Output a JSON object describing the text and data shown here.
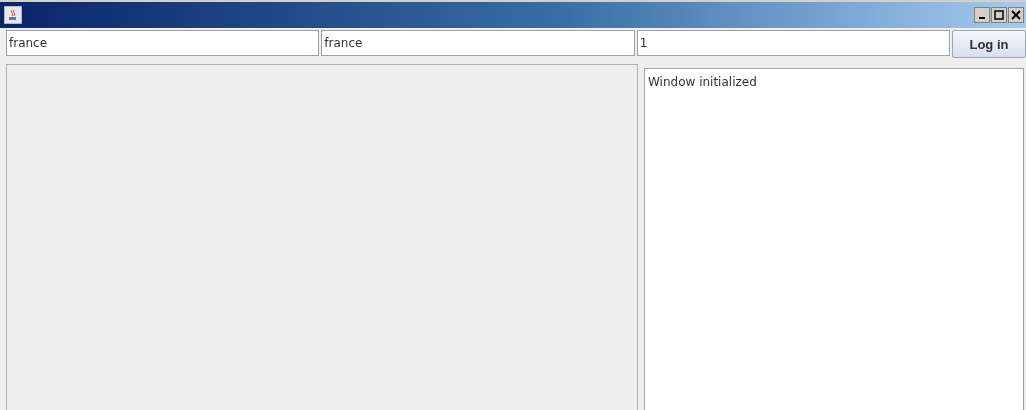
{
  "fields": [
    {
      "value": "france"
    },
    {
      "value": "france"
    },
    {
      "value": "1"
    }
  ],
  "login_button": {
    "label": "Log in"
  },
  "log": {
    "text": "Window initialized"
  }
}
